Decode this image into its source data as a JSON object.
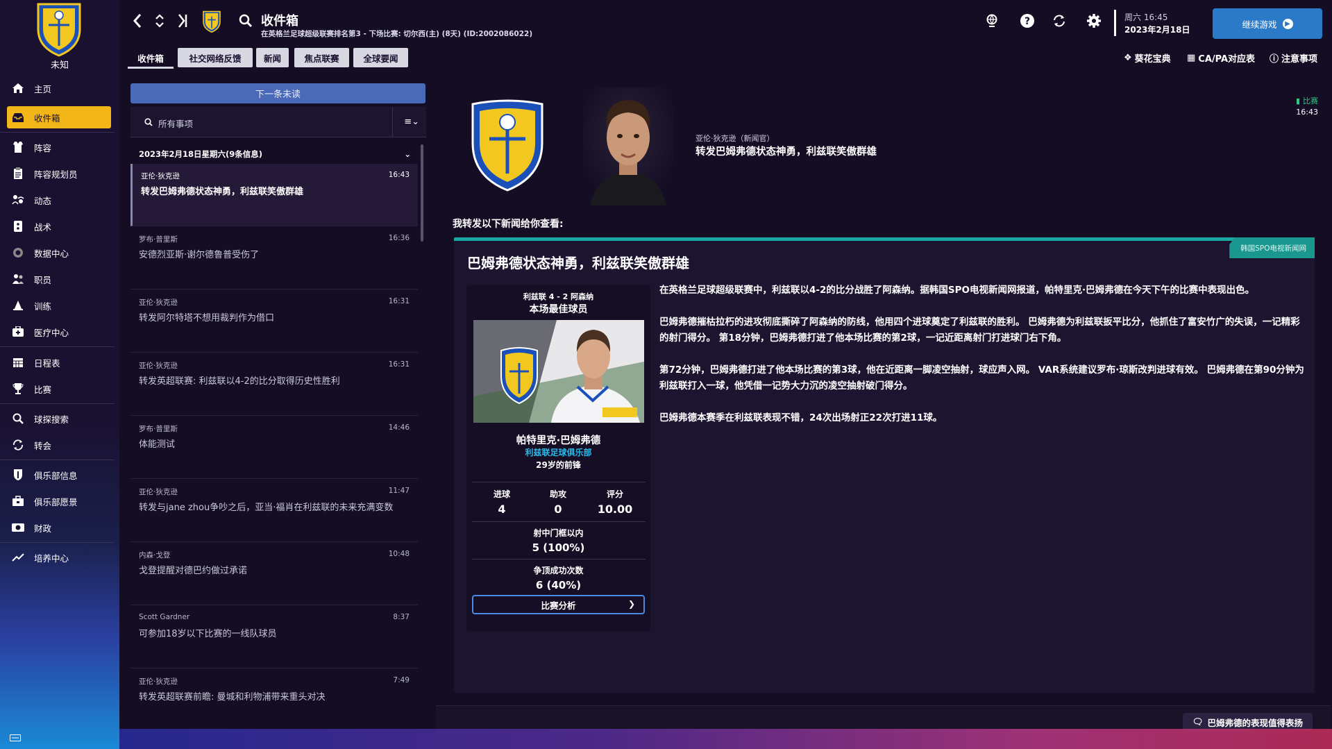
{
  "sidebar": {
    "club_name": "未知",
    "items": [
      {
        "label": "主页",
        "icon": "home-icon"
      },
      {
        "label": "收件箱",
        "icon": "inbox-icon"
      },
      {
        "label": "阵容",
        "icon": "squad-icon"
      },
      {
        "label": "阵容规划员",
        "icon": "clipboard-icon"
      },
      {
        "label": "动态",
        "icon": "dynamics-icon"
      },
      {
        "label": "战术",
        "icon": "tactics-icon"
      },
      {
        "label": "数据中心",
        "icon": "data-hub-icon"
      },
      {
        "label": "职员",
        "icon": "staff-icon"
      },
      {
        "label": "训练",
        "icon": "training-icon"
      },
      {
        "label": "医疗中心",
        "icon": "medical-icon"
      },
      {
        "label": "日程表",
        "icon": "calendar-icon"
      },
      {
        "label": "比赛",
        "icon": "trophy-icon"
      },
      {
        "label": "球探搜索",
        "icon": "scouting-icon"
      },
      {
        "label": "转会",
        "icon": "transfer-icon"
      },
      {
        "label": "俱乐部信息",
        "icon": "club-info-icon"
      },
      {
        "label": "俱乐部愿景",
        "icon": "club-vision-icon"
      },
      {
        "label": "财政",
        "icon": "finances-icon"
      },
      {
        "label": "培养中心",
        "icon": "development-icon"
      }
    ]
  },
  "header": {
    "title": "收件箱",
    "subtitle": "在英格兰足球超级联赛排名第3 - 下场比赛: 切尔西(主) (8天) (ID:2002086022)",
    "date_line1": "周六 16:45",
    "date_line2": "2023年2月18日",
    "continue_label": "继续游戏"
  },
  "tabs": [
    {
      "label": "收件箱"
    },
    {
      "label": "社交网络反馈"
    },
    {
      "label": "新闻"
    },
    {
      "label": "焦点联赛"
    },
    {
      "label": "全球要闻"
    }
  ],
  "top_links": {
    "cheat": "葵花宝典",
    "capa": "CA/PA对应表",
    "notes": "注意事项"
  },
  "inbox": {
    "next_unread": "下一条未读",
    "filter_placeholder": "所有事项",
    "day_header": "2023年2月18日星期六(9条信息)",
    "messages": [
      {
        "sender": "亚伦·狄克逊",
        "time": "16:43",
        "subject": "转发巴姆弗德状态神勇，利兹联笑傲群雄"
      },
      {
        "sender": "罗布·普里斯",
        "time": "16:36",
        "subject": "安德烈亚斯·谢尔德鲁普受伤了"
      },
      {
        "sender": "亚伦·狄克逊",
        "time": "16:31",
        "subject": "转发阿尔特塔不想用裁判作为借口"
      },
      {
        "sender": "亚伦·狄克逊",
        "time": "16:31",
        "subject": "转发英超联赛: 利兹联以4-2的比分取得历史性胜利"
      },
      {
        "sender": "罗布·普里斯",
        "time": "14:46",
        "subject": "体能测试"
      },
      {
        "sender": "亚伦·狄克逊",
        "time": "11:47",
        "subject": "转发与jane zhou争吵之后，亚当·福肖在利兹联的未来充满变数"
      },
      {
        "sender": "内森·戈登",
        "time": "10:48",
        "subject": "戈登提醒对德巴约做过承诺"
      },
      {
        "sender": "Scott Gardner",
        "time": "8:37",
        "subject": "可参加18岁以下比赛的一线队球员"
      },
      {
        "sender": "亚伦·狄克逊",
        "time": "7:49",
        "subject": "转发英超联赛前瞻: 曼城和利物浦带来重头对决"
      }
    ]
  },
  "detail": {
    "sender": "亚伦·狄克逊（新闻官）",
    "title": "转发巴姆弗德状态神勇，利兹联笑傲群雄",
    "badge_label": "比赛",
    "badge_time": "16:43",
    "intro": "我转发以下新闻给你查看:",
    "article": {
      "source": "韩国SPO电视新闻网",
      "title": "巴姆弗德状态神勇，利兹联笑傲群雄",
      "paragraphs": [
        "在英格兰足球超级联赛中，利兹联以4-2的比分战胜了阿森纳。据韩国SPO电视新闻网报道，帕特里克·巴姆弗德在今天下午的比赛中表现出色。",
        "巴姆弗德摧枯拉朽的进攻彻底撕碎了阿森纳的防线，他用四个进球奠定了利兹联的胜利。 巴姆弗德为利兹联扳平比分，他抓住了富安竹广的失误，一记精彩的射门得分。 第18分钟，巴姆弗德打进了他本场比赛的第2球，一记近距离射门打进球门右下角。",
        "第72分钟，巴姆弗德打进了他本场比赛的第3球，他在近距离一脚凌空抽射，球应声入网。 VAR系统建议罗布·琼斯改判进球有效。 巴姆弗德在第90分钟为利兹联打入一球，他凭借一记势大力沉的凌空抽射破门得分。",
        "巴姆弗德本赛季在利兹联表现不错，24次出场射正22次打进11球。"
      ]
    },
    "motm": {
      "score": "利兹联 4 - 2 阿森纳",
      "label": "本场最佳球员",
      "name": "帕特里克·巴姆弗德",
      "club": "利兹联足球俱乐部",
      "age_position": "29岁的前锋",
      "goals_label": "进球",
      "goals": "4",
      "assists_label": "助攻",
      "assists": "0",
      "rating_label": "评分",
      "rating": "10.00",
      "shots_label": "射中门框以内",
      "shots": "5 (100%)",
      "headers_label": "争顶成功次数",
      "headers": "6 (40%)",
      "analysis_label": "比赛分析"
    },
    "reply_label": "巴姆弗德的表现值得表扬"
  },
  "colors": {
    "accent_yellow": "#f2b619",
    "button_blue": "#2a7ac8",
    "article_teal": "#1aa8a0",
    "club_cyan": "#2eb8e8"
  }
}
